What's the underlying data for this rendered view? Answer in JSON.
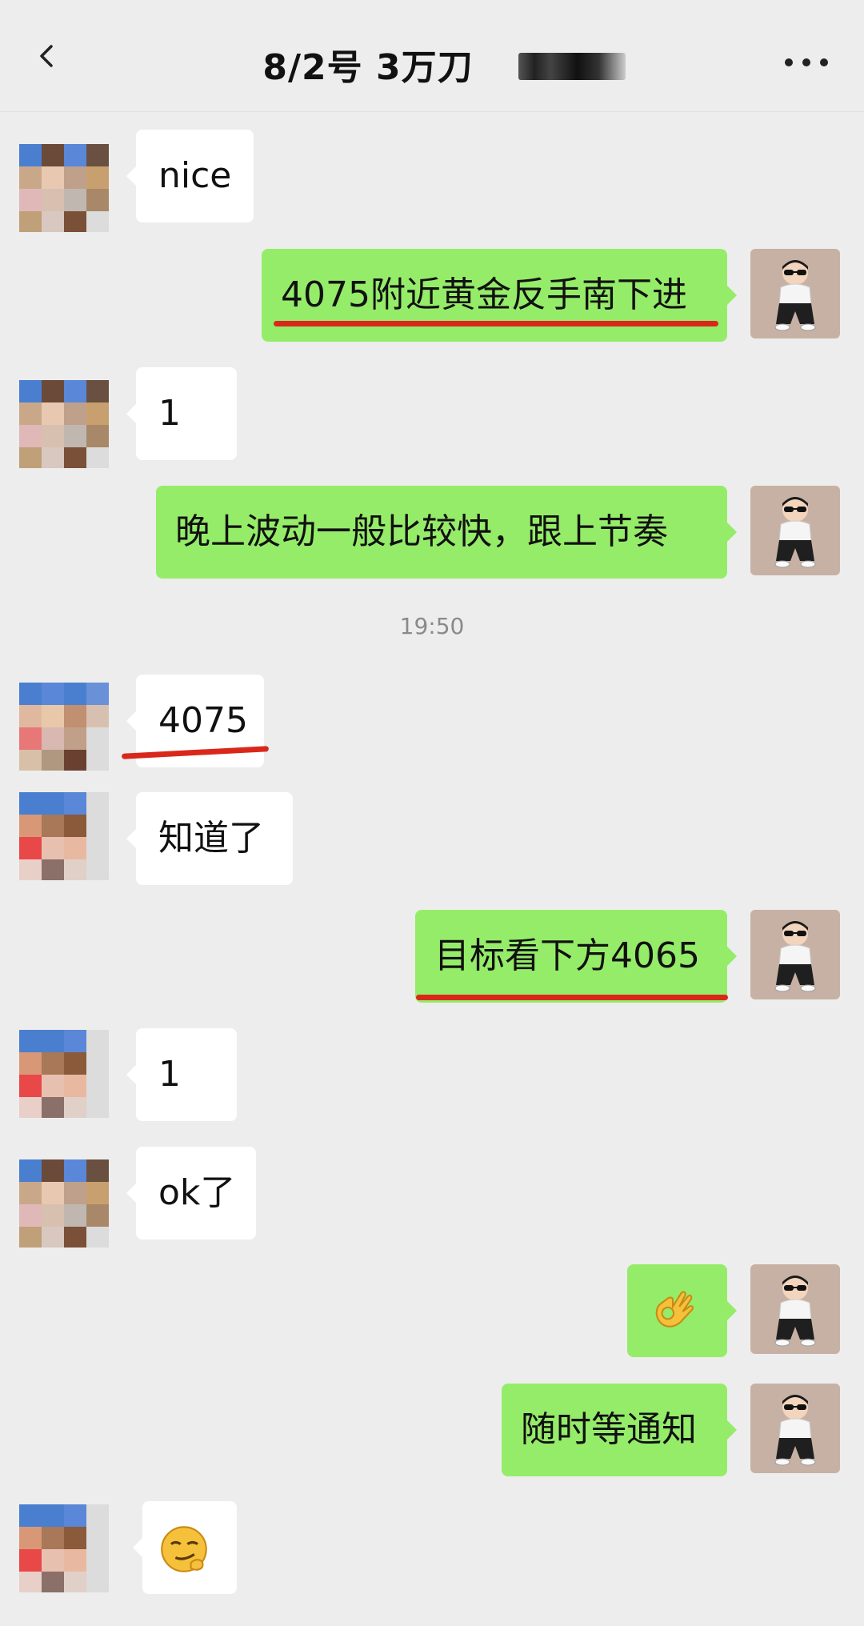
{
  "header": {
    "title": "8/2号  3万刀",
    "back_icon": "chevron-left-icon",
    "more_icon": "more-dots-icon"
  },
  "messages": [
    {
      "side": "left",
      "text": "nice"
    },
    {
      "side": "right",
      "text": "4075附近黄金反手南下进"
    },
    {
      "side": "left",
      "text": "1"
    },
    {
      "side": "right",
      "text": "晚上波动一般比较快，跟上节奏"
    },
    {
      "side": "left",
      "text": "4075"
    },
    {
      "side": "left",
      "text": "知道了"
    },
    {
      "side": "right",
      "text": "目标看下方4065"
    },
    {
      "side": "left",
      "text": "1"
    },
    {
      "side": "left",
      "text": "ok了"
    },
    {
      "side": "right",
      "emoji": "ok-hand-icon"
    },
    {
      "side": "right",
      "text": "随时等通知"
    },
    {
      "side": "left",
      "emoji": "smirk-face-icon"
    }
  ],
  "timestamp": "19:50",
  "colors": {
    "background": "#ededed",
    "bubble_right": "#95ec69",
    "bubble_left": "#ffffff",
    "underline": "#d9281a"
  }
}
